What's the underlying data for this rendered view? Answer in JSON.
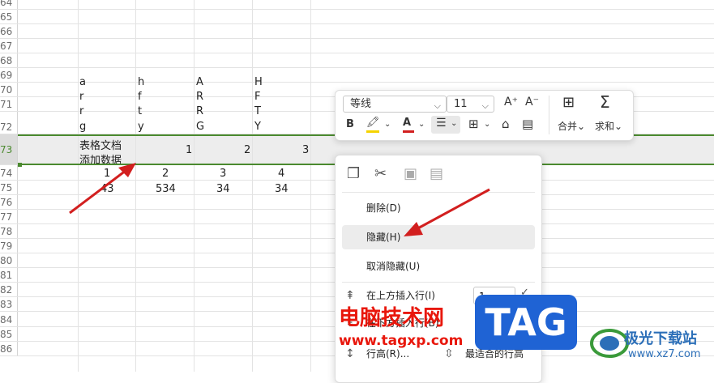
{
  "sheet": {
    "rows": [
      "64",
      "65",
      "66",
      "67",
      "68",
      "69",
      "70",
      "71",
      "72",
      "73",
      "74",
      "75",
      "76",
      "77",
      "78",
      "79",
      "80",
      "81",
      "82",
      "83",
      "84",
      "85",
      "86"
    ],
    "cells": {
      "r69": [
        "a",
        "h",
        "A",
        "H"
      ],
      "r70": [
        "r",
        "f",
        "R",
        "F"
      ],
      "r71": [
        "r",
        "t",
        "R",
        "T"
      ],
      "r72": [
        "g",
        "y",
        "G",
        "Y"
      ],
      "r73_text1": "表格文档",
      "r73_text2": "添加数据",
      "r73_nums": [
        "1",
        "2",
        "3"
      ],
      "r74": [
        "1",
        "2",
        "3",
        "4"
      ],
      "r75": [
        "43",
        "534",
        "34",
        "34"
      ]
    }
  },
  "toolbar": {
    "font_name": "等线",
    "font_size": "11",
    "merge_label": "合并",
    "sum_label": "求和",
    "bold": "B"
  },
  "context_menu": {
    "delete": "删除(D)",
    "hide": "隐藏(H)",
    "unhide": "取消隐藏(U)",
    "insert_above": "在上方插入行(I)",
    "insert_above_count": "1",
    "insert_below": "在下方插入行(B)",
    "row_height": "行高(R)...",
    "best_fit": "最适合的行高"
  },
  "watermark": {
    "brand": "电脑技术网",
    "url": "www.tagxp.com",
    "tag": "TAG",
    "site_name": "极光下载站",
    "site_url": "www.xz7.com"
  },
  "colors": {
    "selection": "#4b8a2f",
    "arrow": "#d21f1f",
    "tag_bg": "#1f63d4"
  }
}
